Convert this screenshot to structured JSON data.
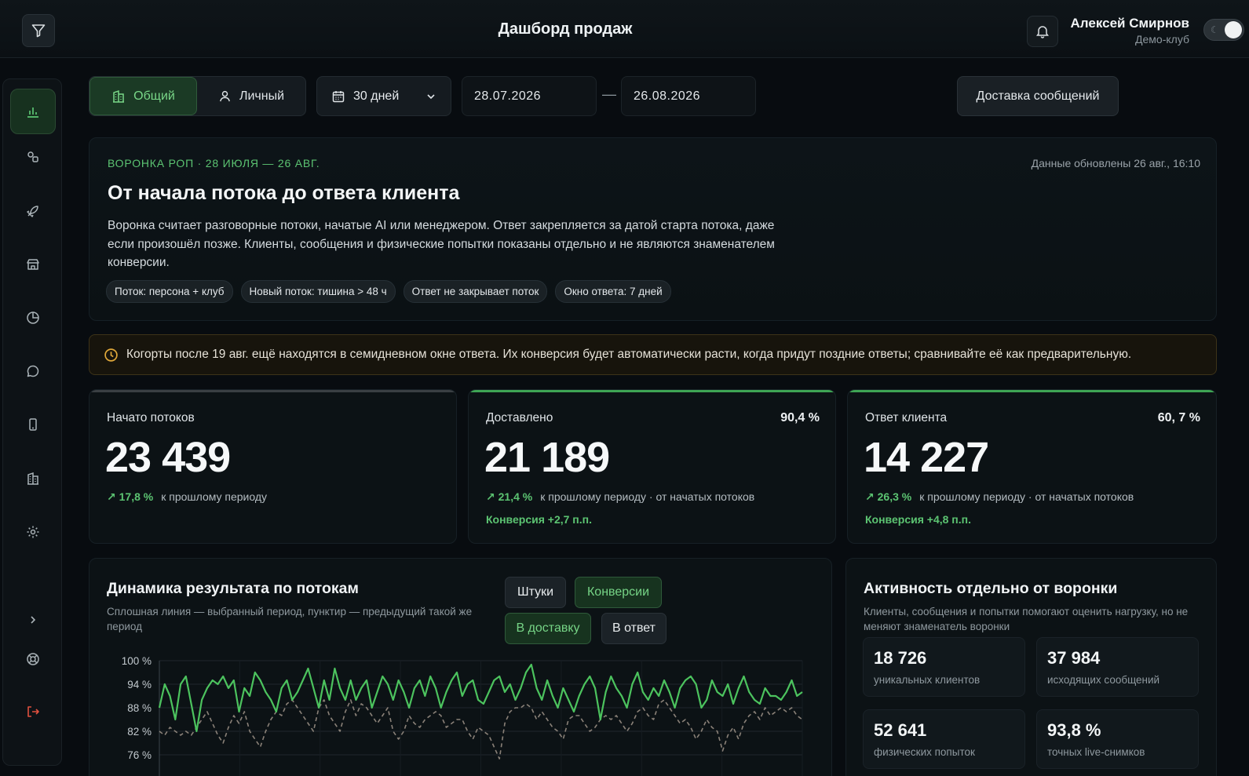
{
  "header": {
    "title": "Дашборд продаж",
    "user_name": "Алексей Смирнов",
    "user_club": "Демо-клуб"
  },
  "sidebar": {
    "items": [
      {
        "icon": "bar-chart-icon",
        "active": true
      },
      {
        "icon": "nodes-icon",
        "active": false
      },
      {
        "icon": "rocket-icon",
        "active": false
      },
      {
        "icon": "store-icon",
        "active": false
      },
      {
        "icon": "pie-chart-icon",
        "active": false
      },
      {
        "icon": "chat-icon",
        "active": false
      },
      {
        "icon": "phone-icon",
        "active": false
      },
      {
        "icon": "building-icon",
        "active": false
      },
      {
        "icon": "gear-icon",
        "active": false
      },
      {
        "icon": "chevron-right-icon",
        "active": false
      },
      {
        "icon": "support-icon",
        "active": false
      },
      {
        "icon": "logout-icon",
        "active": false
      }
    ]
  },
  "filters": {
    "scope_general": "Общий",
    "scope_personal": "Личный",
    "period": "30 дней",
    "date_from": "28.07.2026",
    "date_to": "26.08.2026",
    "date_separator": "—",
    "delivery_button": "Доставка сообщений"
  },
  "intro": {
    "eyebrow": "ВОРОНКА РОП · 28 ИЮЛЯ — 26 АВГ.",
    "updated": "Данные обновлены 26 авг., 16:10",
    "title": "От начала потока до ответа клиента",
    "description": "Воронка считает разговорные потоки, начатые AI или менеджером. Ответ закрепляется за датой старта потока, даже если произошёл позже. Клиенты, сообщения и физические попытки показаны отдельно и не являются знаменателем конверсии.",
    "chips": [
      "Поток: персона + клуб",
      "Новый поток: тишина > 48 ч",
      "Ответ не закрывает поток",
      "Окно ответа: 7 дней"
    ]
  },
  "warning": {
    "text": "Когорты после 19 авг. ещё находятся в семидневном окне ответа. Их конверсия будет автоматически расти, когда придут поздние ответы; сравнивайте её как предварительную."
  },
  "kpis": [
    {
      "label": "Начато потоков",
      "pct": "",
      "value": "23 439",
      "delta": "17,8 %",
      "delta_text": "к прошлому периоду",
      "conversion": ""
    },
    {
      "label": "Доставлено",
      "pct": "90,4 %",
      "value": "21 189",
      "delta": "21,4 %",
      "delta_text": "к прошлому периоду · от начатых потоков",
      "conversion": "Конверсия +2,7 п.п."
    },
    {
      "label": "Ответ клиента",
      "pct": "60, 7 %",
      "value": "14 227",
      "delta": "26,3 %",
      "delta_text": "к прошлому периоду · от начатых потоков",
      "conversion": "Конверсия +4,8 п.п."
    }
  ],
  "dynamics": {
    "title": "Динамика результата по потокам",
    "subtitle": "Сплошная линия — выбранный период, пунктир — предыдущий такой же период",
    "toggle_units": "Штуки",
    "toggle_conversions": "Конверсии",
    "toggle_to_delivery": "В доставку",
    "toggle_to_reply": "В ответ"
  },
  "chart_data": {
    "type": "line",
    "ylim": [
      73,
      100
    ],
    "y_ticks": [
      "100 %",
      "94 %",
      "88 %",
      "82 %",
      "76 %"
    ],
    "grid": true,
    "series": [
      {
        "style": "solid",
        "color": "#4cc35e",
        "values": [
          88,
          94,
          91,
          85,
          94,
          96,
          89,
          82,
          90,
          93,
          95,
          94,
          96,
          93,
          95,
          87,
          93,
          91,
          97,
          95,
          92,
          90,
          87,
          93,
          95,
          90,
          92,
          95,
          98,
          93,
          88,
          95,
          90,
          98,
          93,
          90,
          95,
          90,
          93,
          95,
          88,
          92,
          96,
          94,
          90,
          95,
          92,
          88,
          93,
          95,
          91,
          96,
          93,
          88,
          92,
          95,
          97,
          91,
          94,
          95,
          90,
          89,
          92,
          95,
          96,
          92,
          94,
          90,
          93,
          97,
          99,
          93,
          90,
          95,
          91,
          88,
          93,
          90,
          87,
          91,
          94,
          96,
          93,
          85,
          92,
          96,
          93,
          91,
          88,
          94,
          97,
          92,
          90,
          93,
          91,
          95,
          92,
          88,
          93,
          95,
          96,
          94,
          88,
          90,
          95,
          92,
          91,
          94,
          89,
          93,
          96,
          92,
          90,
          89,
          93,
          91,
          91,
          90,
          92,
          95,
          91,
          92
        ]
      },
      {
        "style": "dashed",
        "color": "#8a8178",
        "values": [
          82,
          81,
          83,
          82,
          81,
          82,
          81,
          83,
          85,
          87,
          84,
          81,
          79,
          83,
          86,
          84,
          87,
          82,
          80,
          78,
          82,
          85,
          87,
          86,
          89,
          90,
          88,
          86,
          84,
          82,
          88,
          90,
          86,
          84,
          82,
          87,
          90,
          86,
          89,
          88,
          86,
          84,
          86,
          88,
          82,
          80,
          82,
          86,
          84,
          83,
          85,
          86,
          87,
          86,
          83,
          84,
          85,
          85,
          82,
          80,
          83,
          82,
          81,
          78,
          75,
          84,
          87,
          88,
          88,
          89,
          88,
          85,
          87,
          85,
          83,
          82,
          80,
          85,
          86,
          86,
          84,
          82,
          83,
          85,
          86,
          85,
          86,
          84,
          82,
          84,
          87,
          88,
          86,
          85,
          89,
          90,
          88,
          86,
          84,
          85,
          83,
          80,
          82,
          85,
          83,
          82,
          77,
          81,
          83,
          80,
          84,
          86,
          87,
          85,
          88,
          86,
          87,
          88,
          87,
          88,
          86,
          85
        ]
      }
    ]
  },
  "activity": {
    "title": "Активность отдельно от воронки",
    "subtitle": "Клиенты, сообщения и попытки помогают оценить нагрузку, но не меняют знаменатель воронки",
    "stats": [
      {
        "value": "18 726",
        "caption": "уникальных клиентов"
      },
      {
        "value": "37 984",
        "caption": "исходящих сообщений"
      },
      {
        "value": "52 641",
        "caption": "физических попыток"
      },
      {
        "value": "93,8 %",
        "caption": "точных live-снимков"
      }
    ]
  }
}
